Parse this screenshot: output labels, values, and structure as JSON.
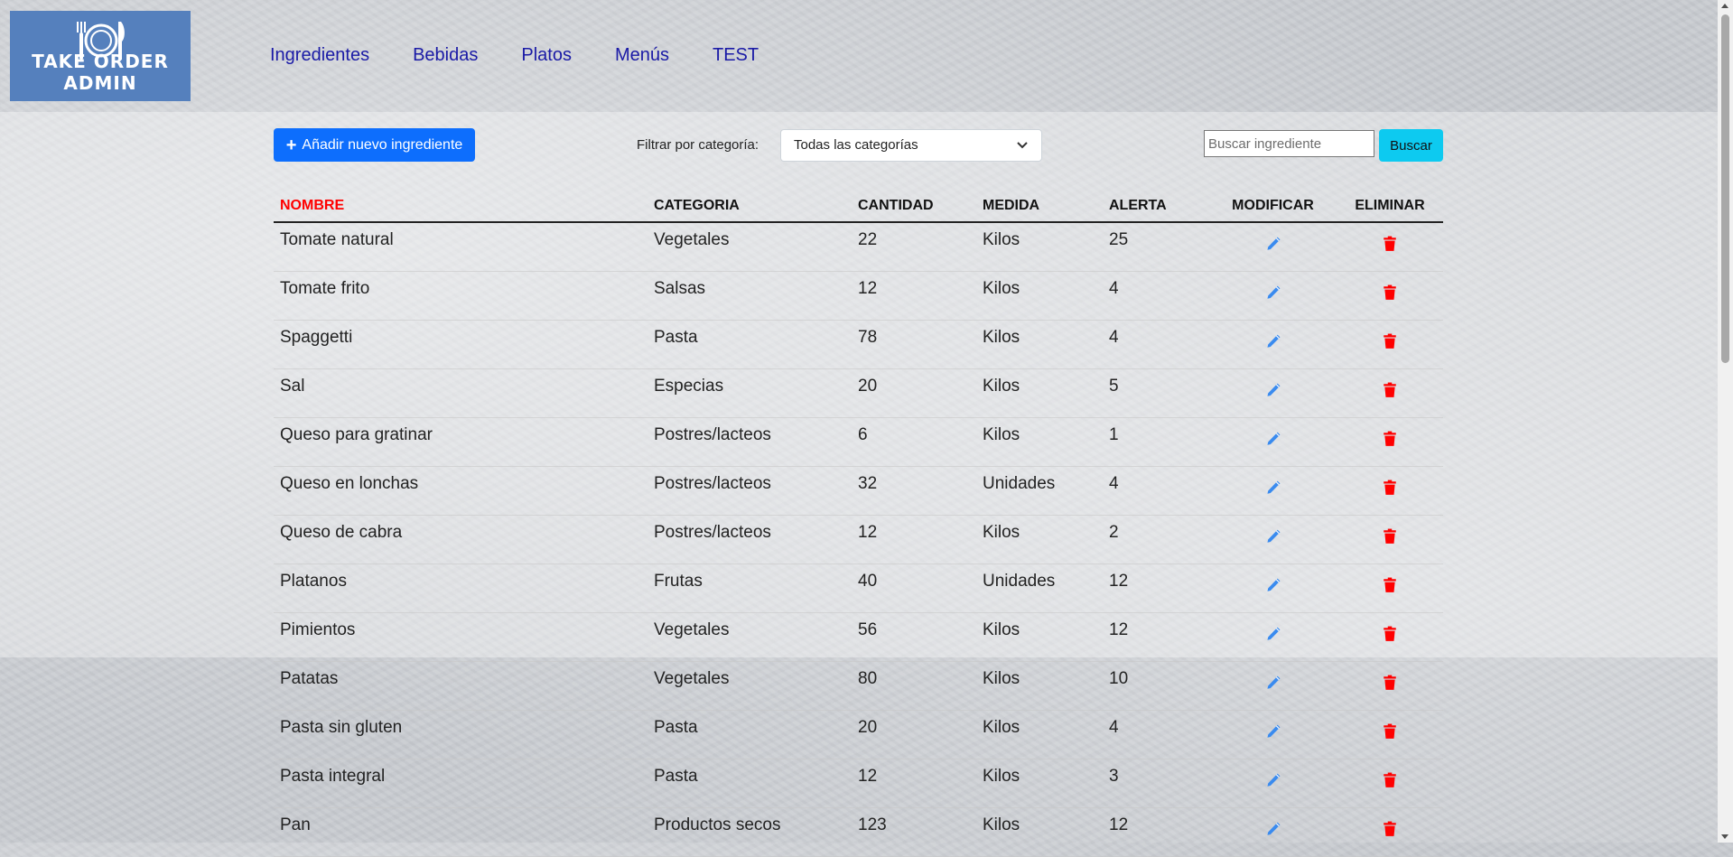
{
  "brand": {
    "title": "TAKE ORDER ADMIN"
  },
  "nav": [
    {
      "label": "Ingredientes"
    },
    {
      "label": "Bebidas"
    },
    {
      "label": "Platos"
    },
    {
      "label": "Menús"
    },
    {
      "label": "TEST"
    }
  ],
  "toolbar": {
    "add_label": "Añadir nuevo ingrediente",
    "filter_label": "Filtrar por categoría:",
    "filter_selected": "Todas las categorías",
    "search_placeholder": "Buscar ingrediente",
    "search_value": "",
    "search_label": "Buscar"
  },
  "table": {
    "headers": [
      "NOMBRE",
      "CATEGORIA",
      "CANTIDAD",
      "MEDIDA",
      "ALERTA",
      "MODIFICAR",
      "ELIMINAR"
    ],
    "sorted_column": "NOMBRE",
    "rows": [
      {
        "nombre": "Tomate natural",
        "categoria": "Vegetales",
        "cantidad": "22",
        "medida": "Kilos",
        "alerta": "25"
      },
      {
        "nombre": "Tomate frito",
        "categoria": "Salsas",
        "cantidad": "12",
        "medida": "Kilos",
        "alerta": "4"
      },
      {
        "nombre": "Spaggetti",
        "categoria": "Pasta",
        "cantidad": "78",
        "medida": "Kilos",
        "alerta": "4"
      },
      {
        "nombre": "Sal",
        "categoria": "Especias",
        "cantidad": "20",
        "medida": "Kilos",
        "alerta": "5"
      },
      {
        "nombre": "Queso para gratinar",
        "categoria": "Postres/lacteos",
        "cantidad": "6",
        "medida": "Kilos",
        "alerta": "1"
      },
      {
        "nombre": "Queso en lonchas",
        "categoria": "Postres/lacteos",
        "cantidad": "32",
        "medida": "Unidades",
        "alerta": "4"
      },
      {
        "nombre": "Queso de cabra",
        "categoria": "Postres/lacteos",
        "cantidad": "12",
        "medida": "Kilos",
        "alerta": "2"
      },
      {
        "nombre": "Platanos",
        "categoria": "Frutas",
        "cantidad": "40",
        "medida": "Unidades",
        "alerta": "12"
      },
      {
        "nombre": "Pimientos",
        "categoria": "Vegetales",
        "cantidad": "56",
        "medida": "Kilos",
        "alerta": "12"
      },
      {
        "nombre": "Patatas",
        "categoria": "Vegetales",
        "cantidad": "80",
        "medida": "Kilos",
        "alerta": "10"
      },
      {
        "nombre": "Pasta sin gluten",
        "categoria": "Pasta",
        "cantidad": "20",
        "medida": "Kilos",
        "alerta": "4"
      },
      {
        "nombre": "Pasta integral",
        "categoria": "Pasta",
        "cantidad": "12",
        "medida": "Kilos",
        "alerta": "3"
      },
      {
        "nombre": "Pan",
        "categoria": "Productos secos",
        "cantidad": "123",
        "medida": "Kilos",
        "alerta": "12"
      }
    ]
  },
  "icons": {
    "edit": "pencil-icon",
    "delete": "trash-icon",
    "add": "plus-icon",
    "logo": "plate-cutlery-icon"
  },
  "colors": {
    "primary": "#0d6efd",
    "info": "#0dcaf0",
    "nav_link": "#1a1aa6",
    "sorted_header": "#ff0000",
    "delete": "#ff0000",
    "edit": "#3a8bef",
    "logo_bg": "#5580bd"
  }
}
